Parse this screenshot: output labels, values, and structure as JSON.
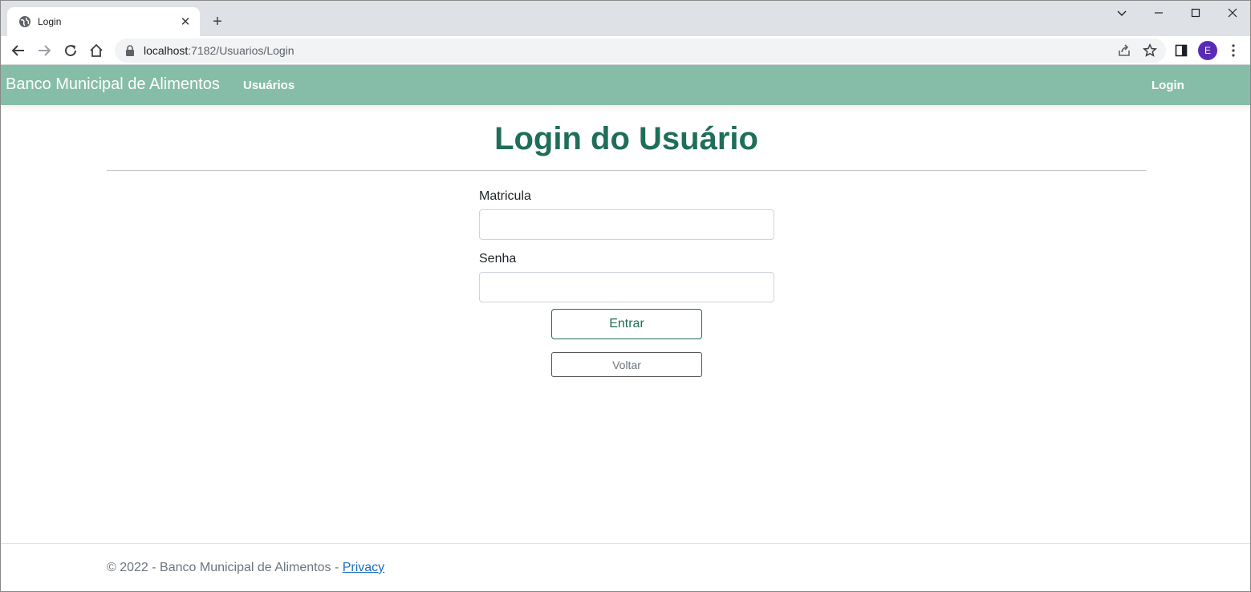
{
  "browser": {
    "tab_title": "Login",
    "url_host": "localhost",
    "url_path": ":7182/Usuarios/Login",
    "profile_initial": "E"
  },
  "site": {
    "brand": "Banco Municipal de Alimentos",
    "nav_users": "Usuários",
    "nav_login": "Login"
  },
  "page": {
    "title": "Login do Usuário",
    "matricula_label": "Matricula",
    "senha_label": "Senha",
    "enter_button": "Entrar",
    "back_button": "Voltar"
  },
  "footer": {
    "text": "© 2022 - Banco Municipal de Alimentos - ",
    "privacy_link": "Privacy"
  },
  "colors": {
    "navbar": "#86bda9",
    "accent": "#1f6e59",
    "link": "#1b6ec2"
  }
}
